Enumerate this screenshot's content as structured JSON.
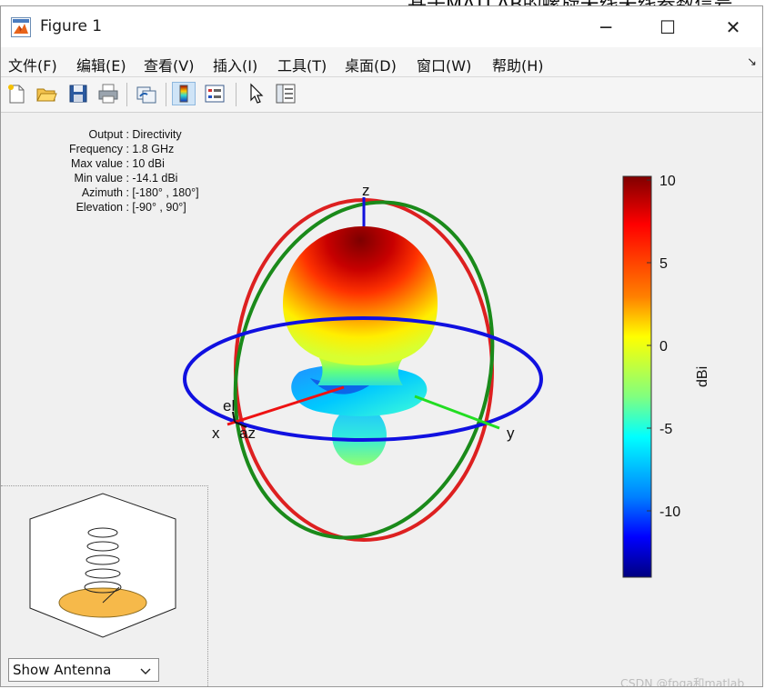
{
  "background_window": {
    "partial_title": "基于MATLAB的螺旋天线天线参数信号"
  },
  "window": {
    "title": "Figure 1",
    "icon": "matlab-figure-icon"
  },
  "window_controls": {
    "minimize": "─",
    "maximize": "☐",
    "close": "✕"
  },
  "menu": {
    "items": [
      {
        "label": "文件(F)"
      },
      {
        "label": "编辑(E)"
      },
      {
        "label": "查看(V)"
      },
      {
        "label": "插入(I)"
      },
      {
        "label": "工具(T)"
      },
      {
        "label": "桌面(D)"
      },
      {
        "label": "窗口(W)"
      },
      {
        "label": "帮助(H)"
      }
    ],
    "undock_icon": "↘"
  },
  "toolbar": {
    "icons": [
      "new-figure-icon",
      "open-file-icon",
      "save-icon",
      "print-icon",
      "link-plot-icon",
      "colorbar-icon",
      "legend-icon",
      "pointer-icon",
      "property-inspector-icon"
    ],
    "active": "colorbar-icon"
  },
  "info": {
    "rows": [
      {
        "label": "Output",
        "value": "Directivity"
      },
      {
        "label": "Frequency",
        "value": "1.8 GHz"
      },
      {
        "label": "Max value",
        "value": "10 dBi"
      },
      {
        "label": "Min value",
        "value": "-14.1 dBi"
      },
      {
        "label": "Azimuth",
        "value": "[-180° , 180°]"
      },
      {
        "label": "Elevation",
        "value": "[-90° , 90°]"
      }
    ]
  },
  "plot": {
    "axis_labels": {
      "z": "z",
      "x": "x",
      "y": "y",
      "el": "el",
      "az": "az"
    },
    "colors": {
      "azimuth_ring": "#1010e0",
      "elevation_ring_xz": "#dd2020",
      "elevation_ring_yz": "#1a8a1a",
      "x_axis": "#ee1111",
      "y_axis": "#22dd22",
      "z_axis": "#1111dd"
    }
  },
  "colorbar": {
    "label": "dBi",
    "ticks": [
      "10",
      "5",
      "0",
      "-5",
      "-10"
    ],
    "range": [
      -14.1,
      10
    ]
  },
  "antenna_view": {
    "select_value": "Show Antenna"
  },
  "watermark": "CSDN @fpga和matlab"
}
